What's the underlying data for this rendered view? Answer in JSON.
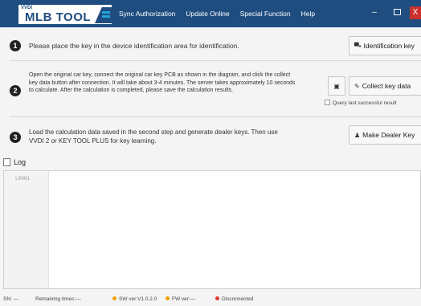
{
  "app": {
    "logo_small": "VVDI",
    "logo_main": "MLB TOOL",
    "menu": [
      "Sync Authorization",
      "Update Online",
      "Special Function",
      "Help"
    ],
    "window_controls": {
      "minimize": "–",
      "close": "X"
    }
  },
  "steps": [
    {
      "number": "1",
      "text": "Please place the key in the device identification area for identification.",
      "button": {
        "icon": "key-icon",
        "label": "Identification key"
      }
    },
    {
      "number": "2",
      "text": "Open the original car key, connect the original car key PCB as shown in the diagram, and click the collect key data button after connection. It will take about 3-4 minutes. The server takes approximately 10 seconds to calculate. After the calculation is completed, please save the calculation results.",
      "icon_button": {
        "icon": "save-icon"
      },
      "button": {
        "icon": "collect-icon",
        "label": "Collect key data"
      },
      "checkbox": {
        "label": "Query last successful result",
        "checked": false
      }
    },
    {
      "number": "3",
      "text": "Load the calculation data saved in the second step and generate dealer keys. Then use VVDI 2 or KEY TOOL PLUS for key learning.",
      "button": {
        "icon": "users-icon",
        "label": "Make Dealer Key"
      }
    }
  ],
  "log": {
    "title": "Log",
    "lines": [
      "L0001"
    ]
  },
  "status": {
    "sn": "SN: —",
    "remaining": "Remaining times:—",
    "sw": "SW ver:V1.0.2.0",
    "fw": "FW ver:—",
    "connection": "Disconnected"
  },
  "colors": {
    "titlebar": "#1f4d80",
    "accent": "#1ea6d8",
    "close": "#c9302c",
    "status_ok": "#f2a200",
    "status_bad": "#e23a2e"
  }
}
